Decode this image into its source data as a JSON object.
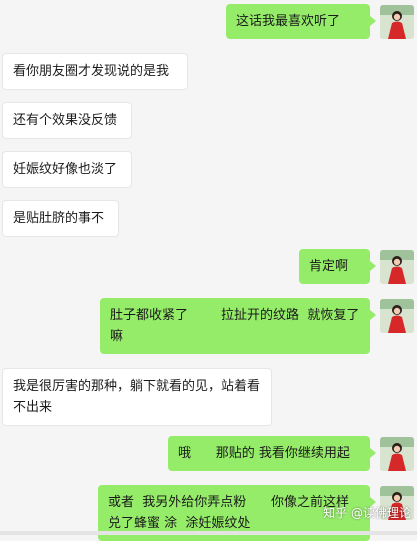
{
  "messages": [
    {
      "side": "out",
      "text": "这话我最喜欢听了"
    },
    {
      "side": "in",
      "text": "看你朋友圈才发现说的是我"
    },
    {
      "side": "in",
      "text": "还有个效果没反馈"
    },
    {
      "side": "in",
      "text": "妊娠纹好像也淡了"
    },
    {
      "side": "in",
      "text": "是贴肚脐的事不"
    },
    {
      "side": "out",
      "text": "肯定啊"
    },
    {
      "side": "out",
      "text": "肚子都收紧了        拉扯开的纹路  就恢复了嘛"
    },
    {
      "side": "in",
      "text": "我是很厉害的那种，躺下就看的见，站着看不出来"
    },
    {
      "side": "out",
      "text": "哦      那贴的 我看你继续用起"
    },
    {
      "side": "out",
      "text": "或者  我另外给你弄点粉      你像之前这样兑了蜂蜜 涂  涂妊娠纹处"
    }
  ],
  "watermark": "知乎 @读佛理论",
  "colors": {
    "outgoing_bubble": "#95ec69",
    "incoming_bubble": "#ffffff",
    "background": "#f5f5f5"
  },
  "avatar_icon": "user-avatar-red-dress"
}
